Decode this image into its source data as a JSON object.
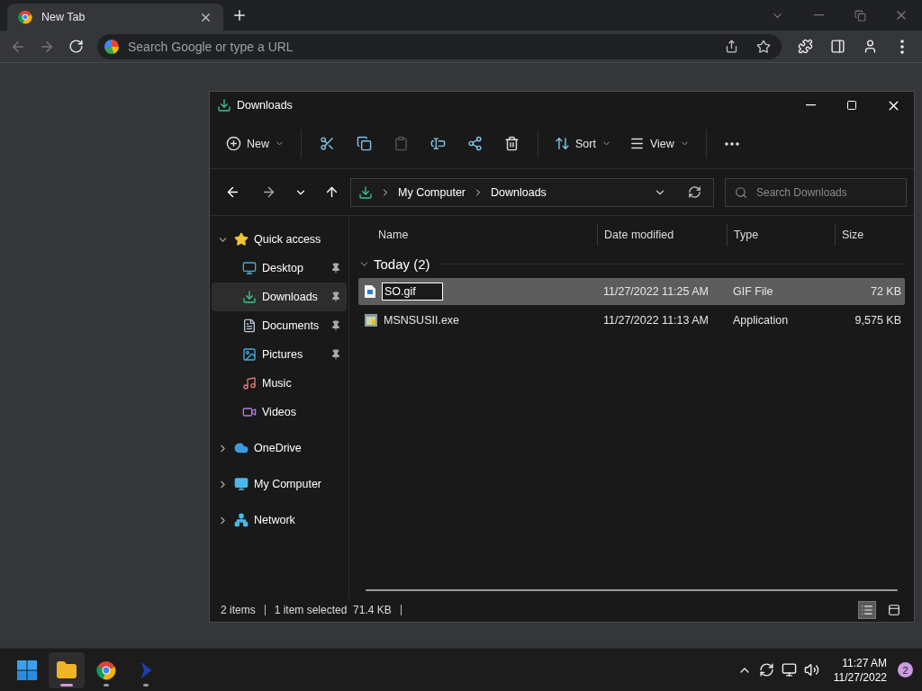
{
  "browser": {
    "tabs": [
      {
        "title": "New Tab",
        "selected": true
      }
    ],
    "address": {
      "placeholder": "Search Google or type a URL"
    }
  },
  "explorer": {
    "title": "Downloads",
    "toolbar": [
      {
        "kind": "menu",
        "label": "New"
      },
      {
        "kind": "icon",
        "disabled": false
      },
      {
        "kind": "icon",
        "disabled": false
      },
      {
        "kind": "icon",
        "disabled": true
      },
      {
        "kind": "icon",
        "disabled": false
      },
      {
        "kind": "icon",
        "disabled": false
      },
      {
        "kind": "icon",
        "disabled": false
      },
      {
        "kind": "menu",
        "label": "Sort"
      },
      {
        "kind": "menu",
        "label": "View"
      },
      {
        "kind": "more"
      }
    ],
    "breadcrumbs": [
      "My Computer",
      "Downloads"
    ],
    "search": {
      "placeholder": "Search Downloads"
    },
    "sidebar": [
      {
        "label": "Quick access",
        "expanded": true,
        "children": [
          {
            "label": "Desktop",
            "pinned": true,
            "selected": false
          },
          {
            "label": "Downloads",
            "pinned": true,
            "selected": true
          },
          {
            "label": "Documents",
            "pinned": true,
            "selected": false
          },
          {
            "label": "Pictures",
            "pinned": true,
            "selected": false
          },
          {
            "label": "Music",
            "pinned": false,
            "selected": false
          },
          {
            "label": "Videos",
            "pinned": false,
            "selected": false
          }
        ]
      },
      {
        "label": "OneDrive",
        "expanded": false
      },
      {
        "label": "My Computer",
        "expanded": false
      },
      {
        "label": "Network",
        "expanded": false
      }
    ],
    "columns": [
      "Name",
      "Date modified",
      "Type",
      "Size"
    ],
    "group": {
      "label": "Today (2)",
      "expanded": true
    },
    "rows": [
      {
        "name": "SO.gif",
        "date": "11/27/2022 11:25 AM",
        "type": "GIF File",
        "size": "72 KB",
        "selected": true,
        "renaming": true
      },
      {
        "name": "MSNSUSII.exe",
        "date": "11/27/2022 11:13 AM",
        "type": "Application",
        "size": "9,575 KB",
        "selected": false,
        "renaming": false
      }
    ],
    "status": [
      "2 items",
      "1 item selected  71.4 KB"
    ],
    "views": [
      {
        "selected": true
      },
      {
        "selected": false
      }
    ]
  },
  "taskbar": {
    "apps": [
      {
        "running": false,
        "selected": false
      },
      {
        "running": true,
        "selected": true
      },
      {
        "running": true,
        "selected": false
      },
      {
        "running": true,
        "selected": false
      }
    ],
    "time": "11:27 AM",
    "date": "11/27/2022",
    "badge": "2"
  }
}
